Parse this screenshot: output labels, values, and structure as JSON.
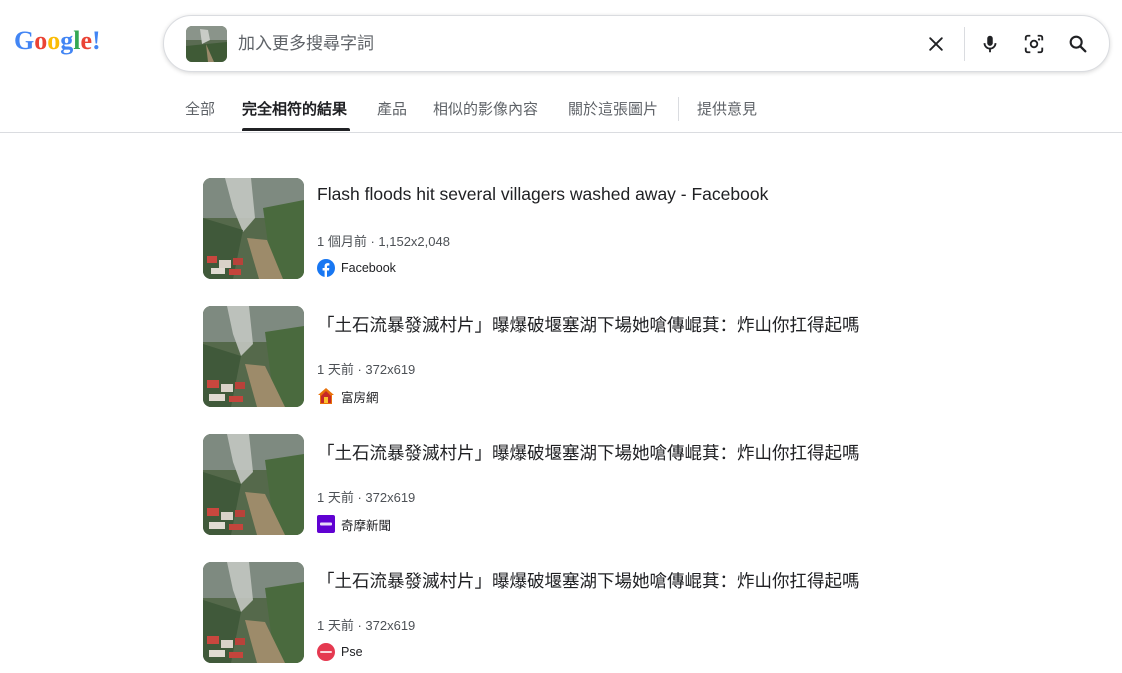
{
  "logo": {
    "letters": [
      "G",
      "o",
      "o",
      "g",
      "l",
      "e",
      "!"
    ],
    "colors": [
      "#4285f4",
      "#ea4335",
      "#fbbc05",
      "#4285f4",
      "#34a853",
      "#ea4335",
      "#4285f4"
    ]
  },
  "search": {
    "placeholder": "加入更多搜尋字詞",
    "value": ""
  },
  "icons": {
    "clear": "close-icon",
    "voice": "microphone-icon",
    "lens": "lens-camera-icon",
    "search": "search-icon"
  },
  "tabs": [
    {
      "label": "全部",
      "active": false
    },
    {
      "label": "完全相符的結果",
      "active": true
    },
    {
      "label": "產品",
      "active": false
    },
    {
      "label": "相似的影像內容",
      "active": false
    },
    {
      "label": "關於這張圖片",
      "active": false
    },
    {
      "label": "提供意見",
      "active": false
    }
  ],
  "results": [
    {
      "title": "Flash floods hit several villagers washed away - Facebook",
      "meta": "1 個月前 · 1,152x2,048",
      "source": "Facebook",
      "favicon": "facebook-icon",
      "favicon_color": "#1877f2"
    },
    {
      "title": "「土石流暴發滅村片」曝爆破堰塞湖下場她嗆傳崐萁：炸山你扛得起嗎",
      "meta": "1 天前 · 372x619",
      "source": "富房網",
      "favicon": "house-logo-icon",
      "favicon_color": "#e8710a"
    },
    {
      "title": "「土石流暴發滅村片」曝爆破堰塞湖下場她嗆傳崐萁：炸山你扛得起嗎",
      "meta": "1 天前 · 372x619",
      "source": "奇摩新聞",
      "favicon": "yahoo-icon",
      "favicon_color": "#6001d2"
    },
    {
      "title": "「土石流暴發滅村片」曝爆破堰塞湖下場她嗆傳崐萁：炸山你扛得起嗎",
      "meta": "1 天前 · 372x619",
      "source": "Pse",
      "favicon": "pse-logo-icon",
      "favicon_color": "#e53950"
    }
  ]
}
